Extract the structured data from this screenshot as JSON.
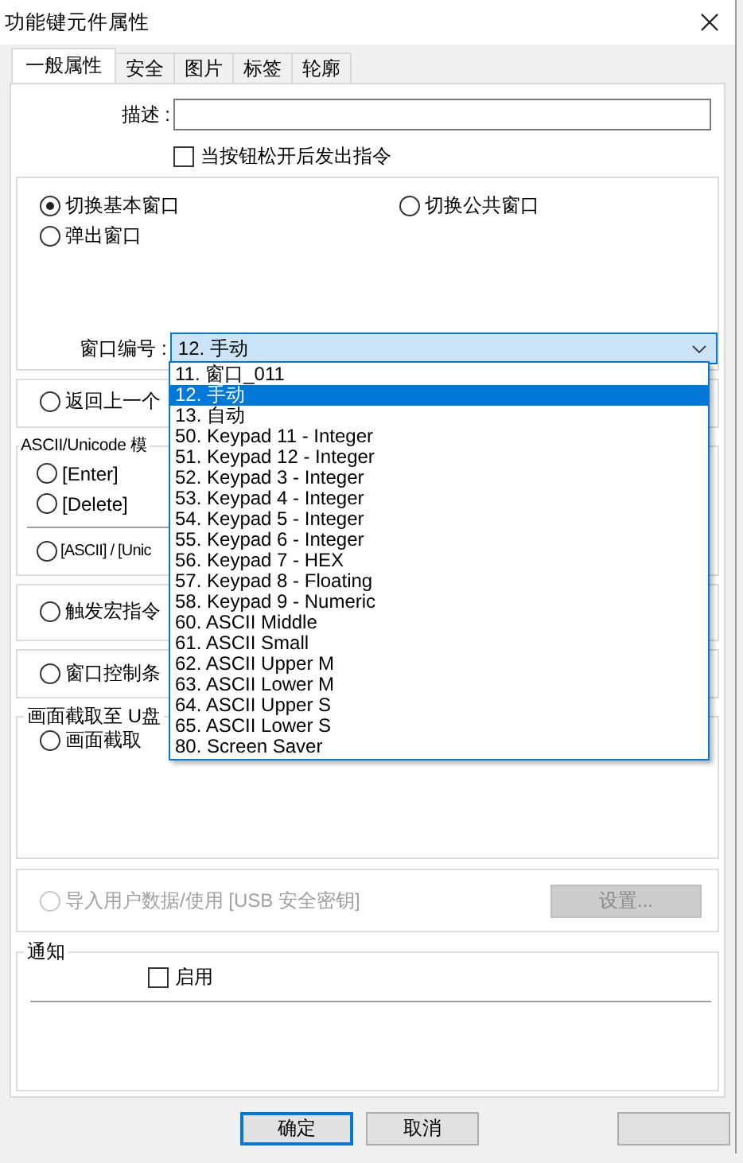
{
  "window": {
    "title": "功能键元件属性"
  },
  "tabs": [
    {
      "label": "一般属性",
      "selected": true
    },
    {
      "label": "安全",
      "selected": false
    },
    {
      "label": "图片",
      "selected": false
    },
    {
      "label": "标签",
      "selected": false
    },
    {
      "label": "轮廓",
      "selected": false
    }
  ],
  "description": {
    "label": "描述 :"
  },
  "release_checkbox": {
    "label": "当按钮松开后发出指令",
    "checked": false
  },
  "window_switch": {
    "options": [
      {
        "label": "切换基本窗口",
        "selected": true
      },
      {
        "label": "切换公共窗口",
        "selected": false
      },
      {
        "label": "弹出窗口",
        "selected": false
      }
    ],
    "window_number_label": "窗口编号 :",
    "window_number": "12. 手动",
    "dropdown": [
      {
        "label": "11. 窗口_011",
        "selected": false
      },
      {
        "label": "12. 手动",
        "selected": true
      },
      {
        "label": "13. 自动",
        "selected": false
      },
      {
        "label": "50. Keypad 11 - Integer",
        "selected": false
      },
      {
        "label": "51. Keypad 12 - Integer",
        "selected": false
      },
      {
        "label": "52. Keypad 3 - Integer",
        "selected": false
      },
      {
        "label": "53. Keypad 4 - Integer",
        "selected": false
      },
      {
        "label": "54. Keypad 5 - Integer",
        "selected": false
      },
      {
        "label": "55. Keypad 6 - Integer",
        "selected": false
      },
      {
        "label": "56. Keypad 7 - HEX",
        "selected": false
      },
      {
        "label": "57. Keypad 8 - Floating",
        "selected": false
      },
      {
        "label": "58. Keypad 9 - Numeric",
        "selected": false
      },
      {
        "label": "60. ASCII Middle",
        "selected": false
      },
      {
        "label": "61. ASCII Small",
        "selected": false
      },
      {
        "label": "62. ASCII Upper M",
        "selected": false
      },
      {
        "label": "63. ASCII Lower M",
        "selected": false
      },
      {
        "label": "64. ASCII Upper S",
        "selected": false
      },
      {
        "label": "65. ASCII Lower S",
        "selected": false
      },
      {
        "label": "80. Screen Saver",
        "selected": false
      }
    ]
  },
  "sections": [
    {
      "option_groups": [
        {
          "options": [
            {
              "label": "返回上一个",
              "selected": false,
              "disabled": false
            }
          ]
        }
      ]
    },
    {
      "legend": "ASCII/Unicode 模",
      "option_groups": [
        {
          "options": [
            {
              "label": "[Enter]",
              "selected": false,
              "disabled": false
            },
            {
              "label": "[Delete]",
              "selected": false,
              "disabled": false
            }
          ]
        },
        {
          "options": [
            {
              "label": "[ASCII] / [Unic",
              "selected": false,
              "disabled": false
            }
          ]
        }
      ]
    },
    {
      "option_groups": [
        {
          "options": [
            {
              "label": "触发宏指令",
              "selected": false,
              "disabled": false
            }
          ]
        }
      ]
    },
    {
      "option_groups": [
        {
          "options": [
            {
              "label": "窗口控制条",
              "selected": false,
              "disabled": false
            }
          ]
        }
      ]
    },
    {
      "legend": "画面截取至 U盘",
      "option_groups": [
        {
          "options": [
            {
              "label": "画面截取",
              "selected": false,
              "disabled": false
            }
          ]
        }
      ]
    },
    {
      "option_groups": [
        {
          "options": [
            {
              "label": "导入用户数据/使用 [USB 安全密钥]",
              "selected": false,
              "disabled": true
            }
          ]
        }
      ],
      "button": {
        "label": "设置...",
        "disabled": true
      }
    }
  ],
  "notification": {
    "legend": "通知",
    "checkbox": {
      "label": "启用",
      "checked": false
    }
  },
  "footer_buttons": [
    {
      "label": "确定",
      "default": true
    },
    {
      "label": "取消",
      "default": false
    },
    {
      "default": false
    }
  ]
}
